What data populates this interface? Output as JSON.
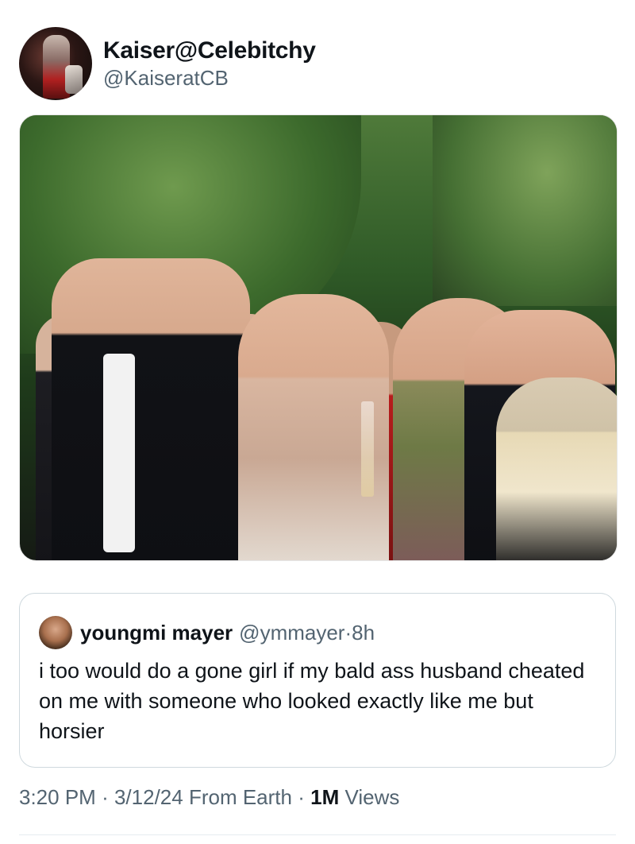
{
  "author": {
    "display_name": "Kaiser@Celebitchy",
    "handle": "@KaiseratCB"
  },
  "quoted_tweet": {
    "display_name": "youngmi mayer",
    "handle": "@ymmayer",
    "separator": "·",
    "time_ago": "8h",
    "text": "i too would do a gone girl if my bald ass husband cheated on me with someone who looked exactly like me but horsier"
  },
  "meta": {
    "time": "3:20 PM",
    "dot": "·",
    "date": "3/12/24",
    "location": "From Earth",
    "views_count": "1M",
    "views_label": "Views"
  },
  "icons": {
    "author_avatar": "profile-avatar-photo",
    "quoted_avatar": "profile-avatar-photo"
  }
}
